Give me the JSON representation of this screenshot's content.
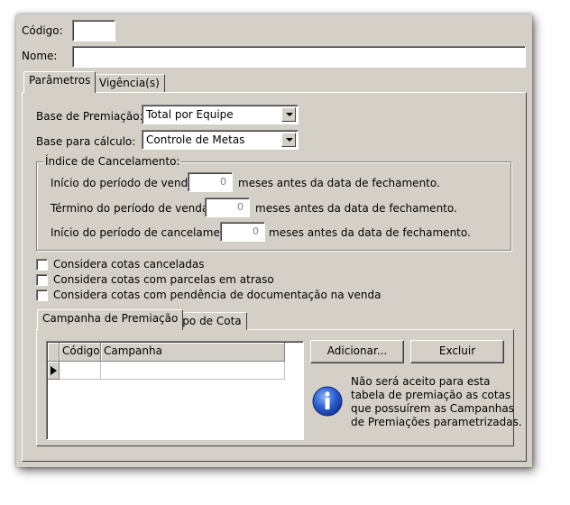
{
  "form": {
    "codigo_label": "Código:",
    "codigo_value": "",
    "nome_label": "Nome:",
    "nome_value": ""
  },
  "tabs": {
    "parametros": "Parâmetros",
    "vigencia": "Vigência(s)"
  },
  "parametros": {
    "base_premiacao_label": "Base de Premiação:",
    "base_premiacao_value": "Total por Equipe",
    "base_calculo_label": "Base para cálculo:",
    "base_calculo_value": "Controle de Metas"
  },
  "cancelamento": {
    "group_title": "Índice de Cancelamento:",
    "inicio_vendas_label": "Início do período de vendas",
    "inicio_vendas_value": "0",
    "termino_vendas_label": "Término do período de vendas",
    "termino_vendas_value": "0",
    "inicio_cancel_label": "Início do período de cancelamento",
    "inicio_cancel_value": "0",
    "suffix": "meses antes da data de fechamento."
  },
  "checkboxes": {
    "canceladas": "Considera cotas canceladas",
    "atraso": "Considera cotas com parcelas em atraso",
    "pendencia": "Considera cotas com pendência de documentação na venda"
  },
  "subtabs": {
    "campanha": "Campanha de Premiação",
    "tipo_cota": "Tipo de Cota"
  },
  "grid": {
    "col_codigo": "Código",
    "col_campanha": "Campanha"
  },
  "buttons": {
    "adicionar": "Adicionar...",
    "excluir": "Excluir"
  },
  "info": {
    "line1": "Não será aceito para esta",
    "line2": "tabela de premiação as cotas",
    "line3": "que possuírem as Campanhas",
    "line4": "de Premiações parametrizadas.",
    "icon_color": "#1f4fbf"
  }
}
